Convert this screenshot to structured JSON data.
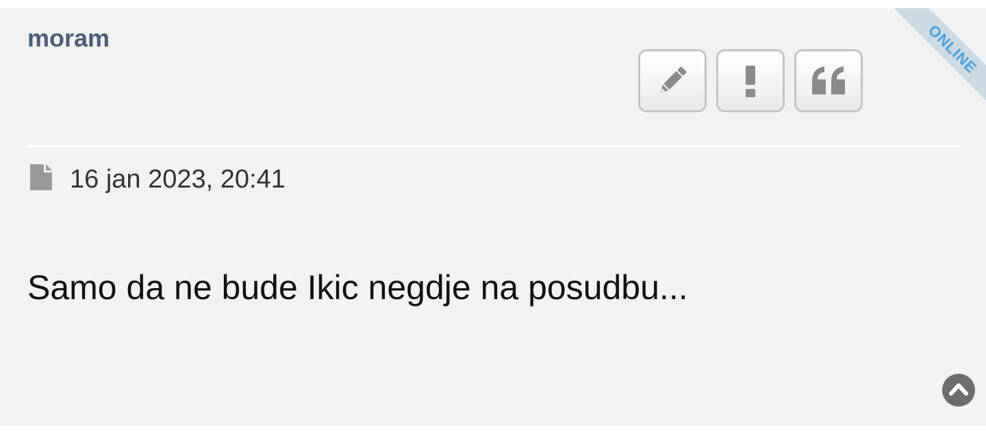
{
  "post": {
    "author": "moram",
    "status_ribbon": "ONLINE",
    "timestamp": "16 jan 2023, 20:41",
    "content": "Samo da ne bude Ikic negdje na posudbu...",
    "actions": [
      {
        "icon": "pencil-icon",
        "title": "Edit"
      },
      {
        "icon": "exclamation-icon",
        "title": "Report"
      },
      {
        "icon": "quote-icon",
        "title": "Quote"
      }
    ]
  },
  "colors": {
    "author": "#4c5d77",
    "background": "#f2f2f2",
    "ribbon_bg": "#cbd9e2",
    "ribbon_text": "#47a2e0",
    "icon": "#8a8a8a"
  }
}
